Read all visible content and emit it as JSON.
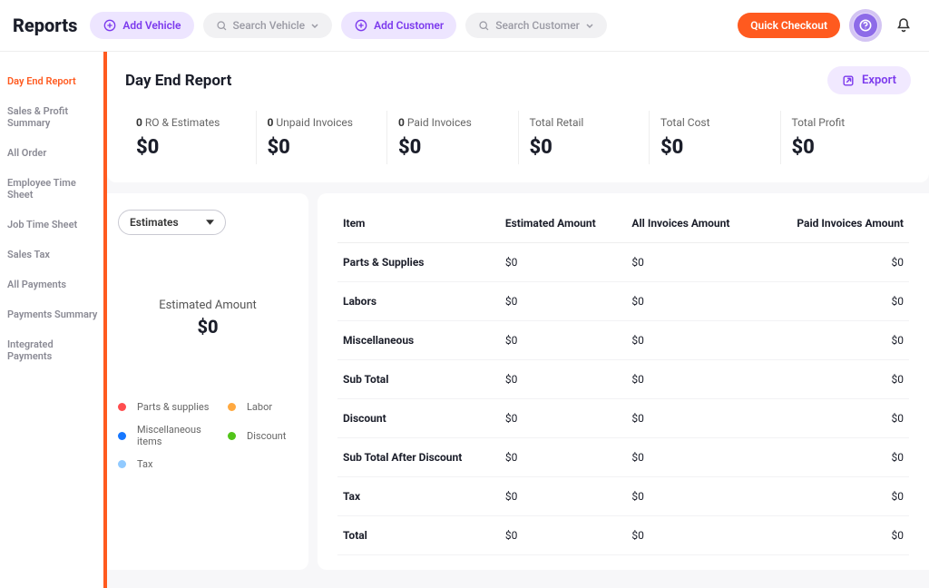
{
  "header": {
    "brand": "Reports",
    "add_vehicle": "Add Vehicle",
    "search_vehicle": "Search Vehicle",
    "add_customer": "Add Customer",
    "search_customer": "Search Customer",
    "quick_checkout": "Quick Checkout"
  },
  "sidebar": {
    "items": [
      "Day End Report",
      "Sales & Profit Summary",
      "All Order",
      "Employee Time Sheet",
      "Job Time Sheet",
      "Sales Tax",
      "All Payments",
      "Payments Summary",
      "Integrated Payments"
    ]
  },
  "page": {
    "title": "Day End Report",
    "export": "Export"
  },
  "stats": [
    {
      "count": "0",
      "label": "RO & Estimates",
      "value": "$0"
    },
    {
      "count": "0",
      "label": "Unpaid Invoices",
      "value": "$0"
    },
    {
      "count": "0",
      "label": "Paid Invoices",
      "value": "$0"
    },
    {
      "count": "",
      "label": "Total Retail",
      "value": "$0"
    },
    {
      "count": "",
      "label": "Total Cost",
      "value": "$0"
    },
    {
      "count": "",
      "label": "Total Profit",
      "value": "$0"
    }
  ],
  "donut": {
    "dropdown": "Estimates",
    "label": "Estimated Amount",
    "value": "$0"
  },
  "legend": {
    "items": [
      {
        "color": "#ff4d4f",
        "label": "Parts & supplies"
      },
      {
        "color": "#ffa940",
        "label": "Labor"
      },
      {
        "color": "#1677ff",
        "label": "Miscellaneous items"
      },
      {
        "color": "#52c41a",
        "label": "Discount"
      },
      {
        "color": "#91caff",
        "label": "Tax"
      }
    ]
  },
  "table": {
    "headers": [
      "Item",
      "Estimated Amount",
      "All Invoices Amount",
      "Paid Invoices Amount"
    ],
    "rows": [
      {
        "item": "Parts & Supplies",
        "est": "$0",
        "all": "$0",
        "paid": "$0"
      },
      {
        "item": "Labors",
        "est": "$0",
        "all": "$0",
        "paid": "$0"
      },
      {
        "item": "Miscellaneous",
        "est": "$0",
        "all": "$0",
        "paid": "$0"
      },
      {
        "item": "Sub Total",
        "est": "$0",
        "all": "$0",
        "paid": "$0"
      },
      {
        "item": "Discount",
        "est": "$0",
        "all": "$0",
        "paid": "$0"
      },
      {
        "item": "Sub Total After Discount",
        "est": "$0",
        "all": "$0",
        "paid": "$0"
      },
      {
        "item": "Tax",
        "est": "$0",
        "all": "$0",
        "paid": "$0"
      },
      {
        "item": "Total",
        "est": "$0",
        "all": "$0",
        "paid": "$0"
      }
    ]
  }
}
